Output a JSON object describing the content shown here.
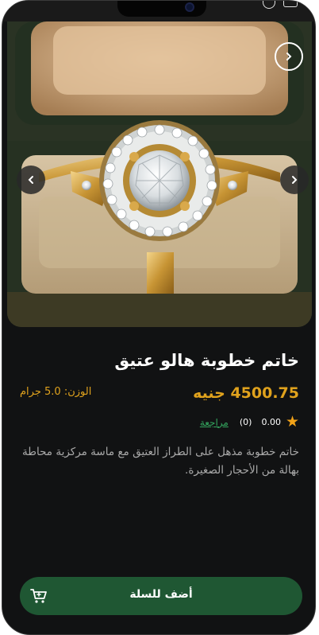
{
  "product": {
    "title": "خاتم خطوبة هالو عتيق",
    "price": "4500.75 جنيه",
    "weight": "الوزن: 5.0 جرام",
    "rating_value": "0.00",
    "rating_count": "(0)",
    "review_label": "مراجعة",
    "description": "خاتم خطوبة مذهل على الطراز العتيق مع ماسة مركزية محاطة بهالة من الأحجار الصغيرة."
  },
  "actions": {
    "add_to_cart_label": "أضف للسلة"
  },
  "icons": {
    "prev": "chevron-left-icon",
    "next": "chevron-right-icon",
    "top_next": "chevron-right-icon",
    "cart": "cart-icon",
    "star": "star-icon"
  },
  "colors": {
    "background": "#111213",
    "accent_gold": "#e0a21d",
    "review_green": "#33a55e",
    "button_green": "#1f5733"
  }
}
